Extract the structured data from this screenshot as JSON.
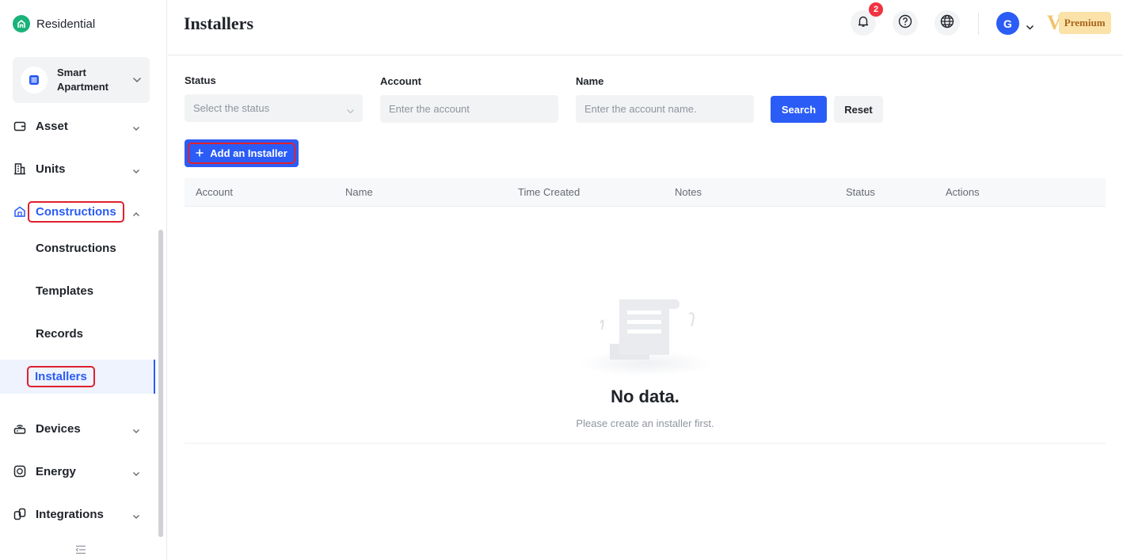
{
  "brand": {
    "name": "Residential",
    "color": "#19b37a"
  },
  "project": {
    "name": "Smart Apartment"
  },
  "sidebar": {
    "items": [
      {
        "label": "Asset",
        "icon": "wallet-icon"
      },
      {
        "label": "Units",
        "icon": "building-icon"
      },
      {
        "label": "Constructions",
        "icon": "house-icon",
        "expanded": true
      },
      {
        "label": "Devices",
        "icon": "router-icon"
      },
      {
        "label": "Energy",
        "icon": "meter-icon"
      },
      {
        "label": "Integrations",
        "icon": "link-icon"
      }
    ],
    "sub_items": [
      {
        "label": "Constructions"
      },
      {
        "label": "Templates"
      },
      {
        "label": "Records"
      },
      {
        "label": "Installers",
        "active": true
      }
    ]
  },
  "header": {
    "title": "Installers",
    "notification_count": "2",
    "avatar_initial": "G",
    "premium_mark": "V",
    "premium_label": "Premium"
  },
  "filters": {
    "status_label": "Status",
    "status_placeholder": "Select the status",
    "account_label": "Account",
    "account_placeholder": "Enter the account",
    "name_label": "Name",
    "name_placeholder": "Enter the account name.",
    "search_label": "Search",
    "reset_label": "Reset"
  },
  "actions": {
    "add_label": "Add an Installer"
  },
  "table": {
    "columns": [
      "Account",
      "Name",
      "Time Created",
      "Notes",
      "Status",
      "Actions"
    ],
    "rows": []
  },
  "empty": {
    "title": "No data.",
    "subtitle": "Please create an installer first."
  },
  "colors": {
    "accent": "#2b5cf6",
    "highlight": "#e0202e",
    "badge": "#f03340"
  }
}
